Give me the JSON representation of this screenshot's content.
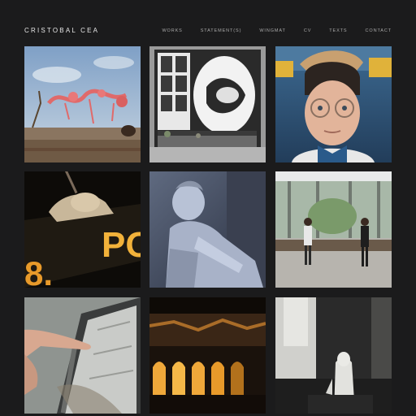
{
  "site": {
    "title": "CRISTOBAL CEA",
    "nav": [
      "WORKS",
      "STATEMENT(S)",
      "WINGMAT",
      "CV",
      "TEXTS",
      "CONTACT"
    ]
  },
  "colors": {
    "background": "#1b1b1c",
    "nav_text": "#a9a9a9",
    "title_text": "#e6e6e6"
  },
  "gallery": {
    "tiles": [
      {
        "name": "tile-surreal-landscape-creature"
      },
      {
        "name": "tile-window-sculpture"
      },
      {
        "name": "tile-3d-boy-with-glasses"
      },
      {
        "name": "tile-led-sign-figure"
      },
      {
        "name": "tile-classical-statue"
      },
      {
        "name": "tile-gallery-performers"
      },
      {
        "name": "tile-hand-tablet"
      },
      {
        "name": "tile-glowing-arches"
      },
      {
        "name": "tile-ghost-figure-hallway"
      }
    ]
  }
}
